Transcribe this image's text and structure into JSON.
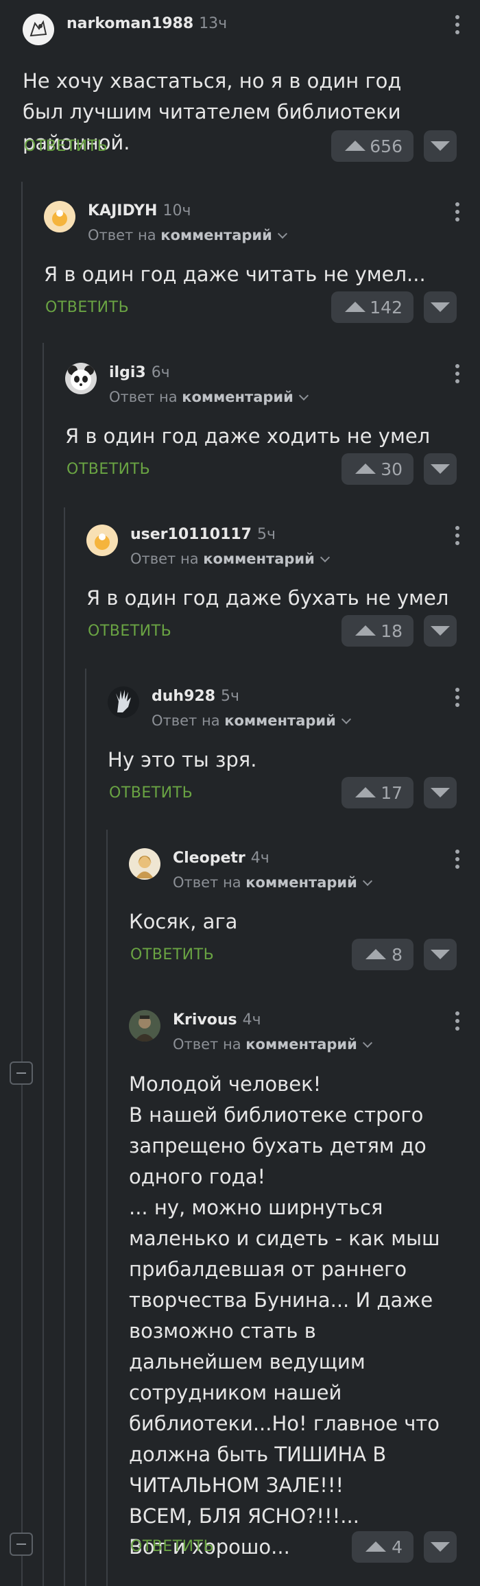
{
  "ui": {
    "reply_label": "ОТВЕТИТЬ",
    "reply_to_prefix": "Ответ на",
    "reply_to_target": "комментарий"
  },
  "comments": [
    {
      "username": "narkoman1988",
      "time": "13ч",
      "text": "Не хочу хвастаться, но я в один год был лучшим читателем библиотеки районной.",
      "rating": "656",
      "avatar": "cat-sketch-avatar"
    },
    {
      "username": "KAJIDYH",
      "time": "10ч",
      "text": "Я в один год даже читать не умел...",
      "rating": "142",
      "avatar": "default-avatar"
    },
    {
      "username": "ilgi3",
      "time": "6ч",
      "text": "Я в один год даже ходить не умел",
      "rating": "30",
      "avatar": "panda-avatar"
    },
    {
      "username": "user10110117",
      "time": "5ч",
      "text": "Я в один год даже бухать не умел",
      "rating": "18",
      "avatar": "default-avatar"
    },
    {
      "username": "duh928",
      "time": "5ч",
      "text": "Ну это ты зря.",
      "rating": "17",
      "avatar": "hand-avatar"
    },
    {
      "username": "Cleopetr",
      "time": "4ч",
      "text": "Косяк, ага",
      "rating": "8",
      "avatar": "woman-avatar"
    },
    {
      "username": "Krivous",
      "time": "4ч",
      "text": "Молодой человек!\nВ нашей библиотеке строго запрещено бухать детям до одного года!\n... ну, можно ширнуться маленько и сидеть - как мыш прибалдевшая от раннего творчества Бунина... И даже возможно стать в дальнейшем ведущим сотрудником нашей библиотеки...Но! главное что должна быть ТИШИНА В ЧИТАЛЬНОМ ЗАЛЕ!!!\nВСЕМ, БЛЯ ЯСНО?!!!...\nВот и хорошо...",
      "rating": "4",
      "avatar": "man-avatar"
    }
  ],
  "colors": {
    "background": "#222528",
    "accent": "#6aa443",
    "button": "#3a3e43"
  }
}
